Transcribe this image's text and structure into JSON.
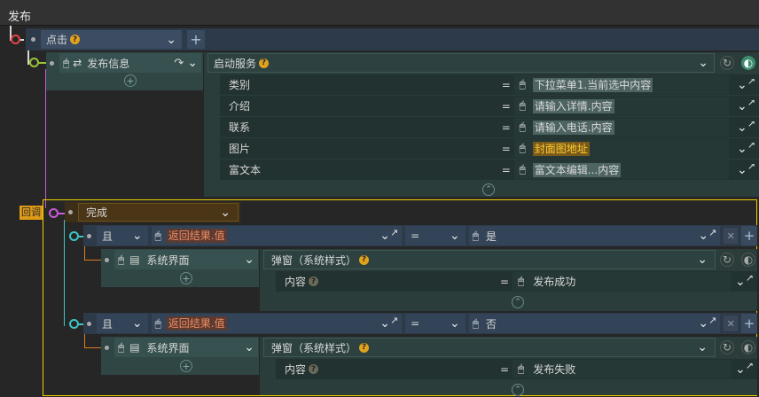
{
  "title": "发布",
  "trigger": {
    "label": "点击",
    "add": "+"
  },
  "action_main": {
    "label": "发布信息"
  },
  "service": {
    "label": "启动服务",
    "params": [
      {
        "name": "类别",
        "eq": "=",
        "value": "下拉菜单1.当前选中内容"
      },
      {
        "name": "介绍",
        "eq": "=",
        "value": "请输入详情.内容"
      },
      {
        "name": "联系",
        "eq": "=",
        "value": "请输入电话.内容"
      },
      {
        "name": "图片",
        "eq": "=",
        "value": "封面图地址"
      },
      {
        "name": "富文本",
        "eq": "=",
        "value": "富文本编辑...内容"
      }
    ]
  },
  "callback": {
    "tag": "回调",
    "label": "完成"
  },
  "conditions": [
    {
      "logic": "且",
      "left": "返回结果.值",
      "op": "=",
      "right": "是",
      "action": "系统界面",
      "popup": "弹窗（系统样式）",
      "content_label": "内容",
      "eq": "=",
      "content_value": "发布成功"
    },
    {
      "logic": "且",
      "left": "返回结果.值",
      "op": "=",
      "right": "否",
      "action": "系统界面",
      "popup": "弹窗（系统样式）",
      "content_label": "内容",
      "eq": "=",
      "content_value": "发布失败"
    }
  ],
  "icons": {
    "help": "?",
    "dropdown": "chevron-down-icon",
    "cursor": "cursor-icon",
    "expand": "expand-icon",
    "add": "plus-icon"
  },
  "colors": {
    "accent_yellow": "#f0d000",
    "callback_tag": "#e09b16",
    "condition_node": "#40c4c4",
    "trigger_node": "#e54444",
    "action_node": "#9ac436",
    "callback_node": "#c85ad8"
  }
}
